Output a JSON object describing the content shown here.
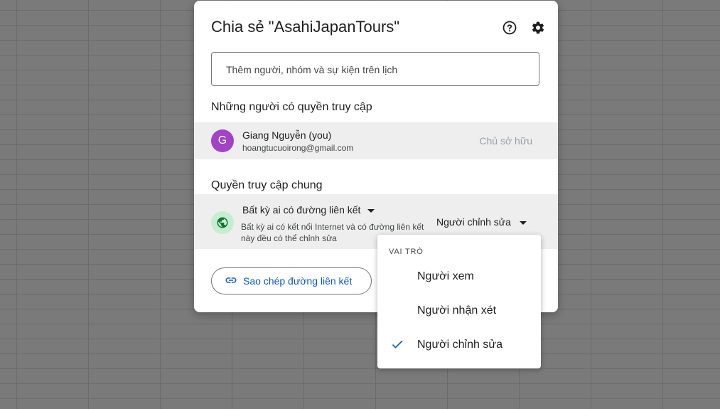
{
  "dialog": {
    "title": "Chia sẻ \"AsahiJapanTours\"",
    "help_icon": "help-circle-icon",
    "settings_icon": "gear-icon",
    "add_placeholder": "Thêm người, nhóm và sự kiện trên lịch",
    "people_section_title": "Những người có quyền truy cập",
    "people": [
      {
        "avatar_letter": "G",
        "avatar_color": "#a142c7",
        "name": "Giang Nguyễn (you)",
        "email": "hoangtucuoirong@gmail.com",
        "role": "Chủ sở hữu"
      }
    ],
    "general_section_title": "Quyền truy cập chung",
    "general_access": {
      "icon": "globe-icon",
      "label": "Bất kỳ ai có đường liên kết",
      "description": "Bất kỳ ai có kết nối Internet và có đường liên kết này đều có thể chỉnh sửa",
      "role": "Người chỉnh sửa"
    },
    "copy_link_label": "Sao chép đường liên kết",
    "copy_link_icon": "link-icon"
  },
  "role_menu": {
    "header": "VAI TRÒ",
    "items": [
      {
        "label": "Người xem",
        "selected": false
      },
      {
        "label": "Người nhận xét",
        "selected": false
      },
      {
        "label": "Người chỉnh sửa",
        "selected": true
      }
    ]
  },
  "colors": {
    "accent": "#0b57d0",
    "avatar": "#a142c7",
    "globe_bg": "#c4eed0",
    "globe_fg": "#137333"
  }
}
